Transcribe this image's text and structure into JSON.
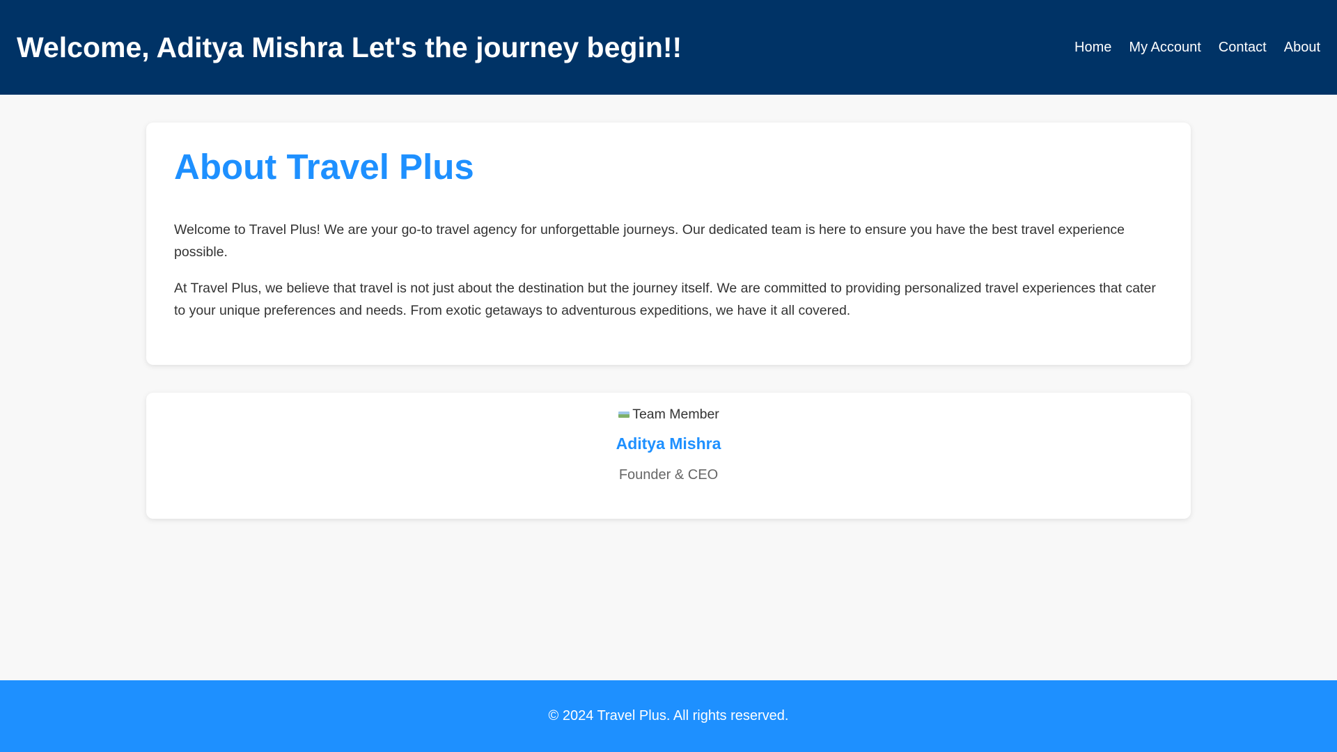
{
  "header": {
    "title": "Welcome, Aditya Mishra Let's the journey begin!!",
    "nav": [
      {
        "label": "Home"
      },
      {
        "label": "My Account"
      },
      {
        "label": "Contact"
      },
      {
        "label": "About"
      }
    ]
  },
  "about": {
    "heading": "About Travel Plus",
    "paragraphs": [
      "Welcome to Travel Plus! We are your go-to travel agency for unforgettable journeys. Our dedicated team is here to ensure you have the best travel experience possible.",
      "At Travel Plus, we believe that travel is not just about the destination but the journey itself. We are committed to providing personalized travel experiences that cater to your unique preferences and needs. From exotic getaways to adventurous expeditions, we have it all covered."
    ]
  },
  "team": {
    "image_alt": "Team Member",
    "member_name": "Aditya Mishra",
    "member_role": "Founder & CEO"
  },
  "footer": {
    "copyright": "© 2024 Travel Plus. All rights reserved."
  },
  "colors": {
    "header_bg": "#003366",
    "accent": "#1e90ff",
    "page_bg": "#f8f8f8",
    "card_bg": "#ffffff",
    "text": "#333333"
  }
}
